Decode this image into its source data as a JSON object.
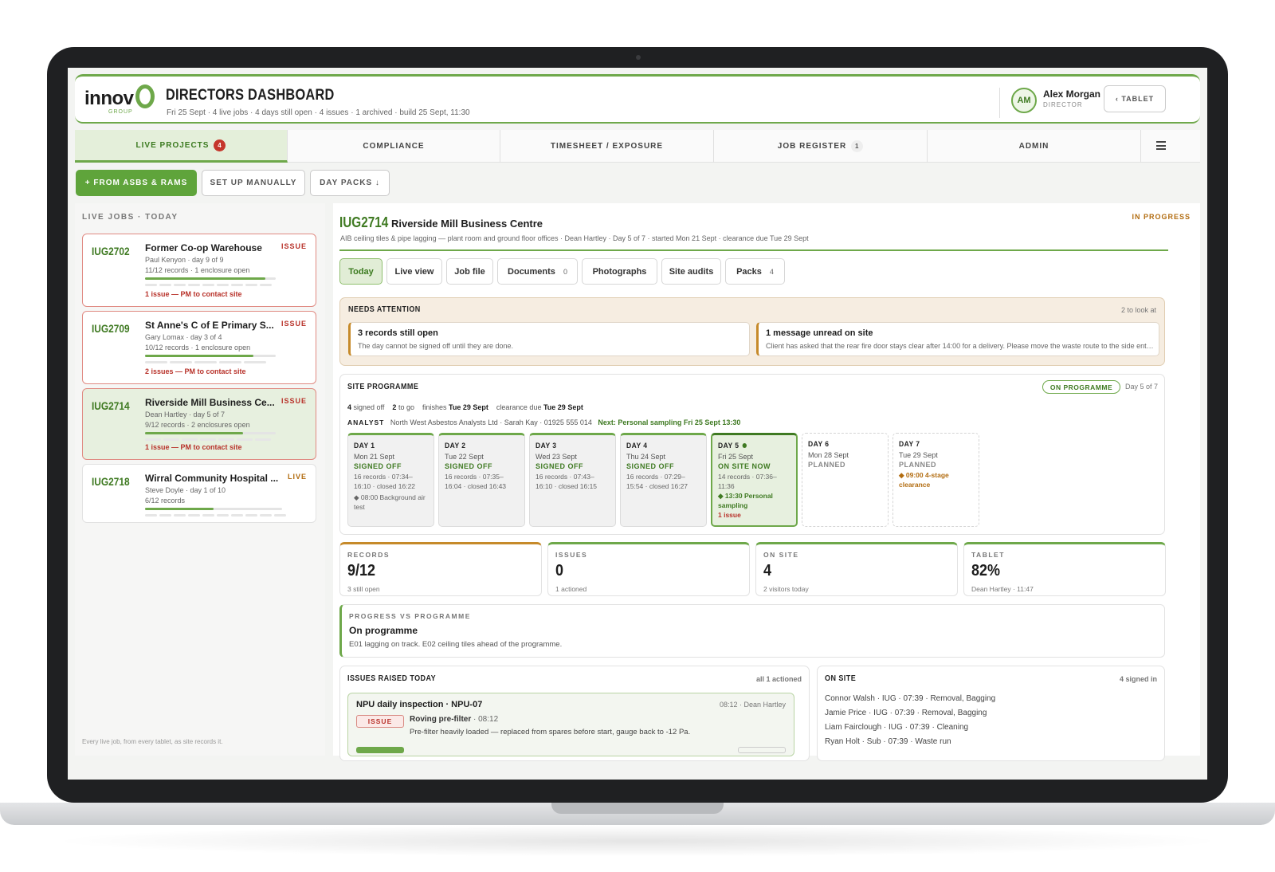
{
  "header": {
    "logo": "innov",
    "logo_sub": "GROUP",
    "title": "DIRECTORS DASHBOARD",
    "subtitle": "Fri 25 Sept · 4 live jobs · 4 days still open · 4 issues · 1 archived · build 25 Sept, 11:30",
    "user_initials": "AM",
    "user_name": "Alex Morgan",
    "user_role": "DIRECTOR",
    "tablet_button": "‹ TABLET"
  },
  "nav": {
    "tabs": [
      {
        "label": "LIVE PROJECTS",
        "badge": "4"
      },
      {
        "label": "COMPLIANCE"
      },
      {
        "label": "TIMESHEET / EXPOSURE"
      },
      {
        "label": "JOB REGISTER",
        "badge": "1"
      },
      {
        "label": "ADMIN"
      }
    ]
  },
  "actions": {
    "from_asbs": "+ FROM ASBS & RAMS",
    "manual": "SET UP MANUALLY",
    "day_packs": "DAY PACKS ↓"
  },
  "left": {
    "heading": "LIVE JOBS · TODAY",
    "footer": "Every live job, from every tablet, as site records it.",
    "jobs": [
      {
        "code": "IUG2702",
        "name": "Former Co-op Warehouse",
        "flag": "ISSUE",
        "meta1": "Paul Kenyon · day 9 of 9",
        "meta2": "11/12 records · 1 enclosure open",
        "issue": "1 issue — PM to contact site",
        "progress": 0.92
      },
      {
        "code": "IUG2709",
        "name": "St Anne's C of E Primary S...",
        "flag": "ISSUE",
        "meta1": "Gary Lomax · day 3 of 4",
        "meta2": "10/12 records · 1 enclosure open",
        "issue": "2 issues — PM to contact site",
        "progress": 0.83
      },
      {
        "code": "IUG2714",
        "name": "Riverside Mill Business Ce...",
        "flag": "ISSUE",
        "meta1": "Dean Hartley · day 5 of 7",
        "meta2": "9/12 records · 2 enclosures open",
        "issue": "1 issue — PM to contact site",
        "progress": 0.75
      },
      {
        "code": "IUG2718",
        "name": "Wirral Community Hospital ...",
        "flag": "LIVE",
        "meta1": "Steve Doyle · day 1 of 10",
        "meta2": "6/12 records",
        "progress": 0.5
      }
    ]
  },
  "main": {
    "code": "IUG2714",
    "name": "Riverside Mill Business Centre",
    "status": "IN PROGRESS",
    "subtitle": "AIB ceiling tiles & pipe lagging — plant room and ground floor offices · Dean Hartley · Day 5 of 7 · started Mon 21 Sept · clearance due Tue 29 Sept",
    "tabs": [
      {
        "label": "Today"
      },
      {
        "label": "Live view"
      },
      {
        "label": "Job file"
      },
      {
        "label": "Documents",
        "n": "0"
      },
      {
        "label": "Photographs"
      },
      {
        "label": "Site audits"
      },
      {
        "label": "Packs",
        "n": "4"
      }
    ],
    "attention": {
      "title": "NEEDS ATTENTION",
      "right": "2 to look at",
      "cards": [
        {
          "title": "3 records still open",
          "sub": "The day cannot be signed off until they are done."
        },
        {
          "title": "1 message unread on site",
          "sub": "Client has asked that the rear fire door stays clear after 14:00 for a delivery. Please move the waste route to the side entrance."
        }
      ]
    },
    "programme": {
      "title": "SITE PROGRAMME",
      "badge": "ON PROGRAMME",
      "day": "Day 5 of 7",
      "signed": "4",
      "signed_l": "signed off",
      "togo": "2",
      "togo_l": "to go",
      "finishes_l": "finishes",
      "finishes": "Tue 29 Sept",
      "clearance_l": "clearance due",
      "clearance": "Tue 29 Sept",
      "analyst_l": "ANALYST",
      "analyst": "North West Asbestos Analysts Ltd · Sarah Kay · 01925 555 014",
      "next": "Next: Personal sampling Fri 25 Sept 13:30",
      "days": [
        {
          "n": "DAY 1",
          "d": "Mon 21 Sept",
          "s": "SIGNED OFF",
          "x": "16 records · 07:34–16:10 · closed 16:22",
          "g": "◆ 08:00 Background air test"
        },
        {
          "n": "DAY 2",
          "d": "Tue 22 Sept",
          "s": "SIGNED OFF",
          "x": "16 records · 07:35–16:04 · closed 16:43"
        },
        {
          "n": "DAY 3",
          "d": "Wed 23 Sept",
          "s": "SIGNED OFF",
          "x": "16 records · 07:43–16:10 · closed 16:15"
        },
        {
          "n": "DAY 4",
          "d": "Thu 24 Sept",
          "s": "SIGNED OFF",
          "x": "16 records · 07:29–15:54 · closed 16:27"
        },
        {
          "n": "DAY 5",
          "d": "Fri 25 Sept",
          "s": "ON SITE NOW",
          "x": "14 records · 07:36–11:36",
          "g": "◆ 13:30 Personal sampling",
          "r": "1 issue"
        },
        {
          "n": "DAY 6",
          "d": "Mon 28 Sept",
          "s": "PLANNED"
        },
        {
          "n": "DAY 7",
          "d": "Tue 29 Sept",
          "s": "PLANNED",
          "a": "◆ 09:00 4-stage clearance"
        }
      ]
    },
    "stats": [
      {
        "label": "RECORDS",
        "value": "9/12",
        "sub": "3 still open"
      },
      {
        "label": "ISSUES",
        "value": "0",
        "sub": "1 actioned"
      },
      {
        "label": "ON SITE",
        "value": "4",
        "sub": "2 visitors today"
      },
      {
        "label": "TABLET",
        "value": "82%",
        "sub": "Dean Hartley · 11:47"
      }
    ],
    "pvp": {
      "label": "PROGRESS VS PROGRAMME",
      "title": "On programme",
      "sub": "E01 lagging on track. E02 ceiling tiles ahead of the programme."
    },
    "issues": {
      "title": "ISSUES RAISED TODAY",
      "right": "all 1 actioned",
      "item_title": "NPU daily inspection · NPU-07",
      "item_meta": "08:12 · Dean Hartley",
      "tag": "ISSUE",
      "line_title": "Roving pre-filter",
      "line_time": "· 08:12",
      "line_sub": "Pre-filter heavily loaded — replaced from spares before start, gauge back to -12 Pa."
    },
    "onsite": {
      "title": "ON SITE",
      "right": "4 signed in",
      "rows": [
        "Connor Walsh · IUG · 07:39 · Removal, Bagging",
        "Jamie Price · IUG · 07:39 · Removal, Bagging",
        "Liam Fairclough · IUG · 07:39 · Cleaning",
        "Ryan Holt · Sub · 07:39 · Waste run"
      ]
    }
  }
}
